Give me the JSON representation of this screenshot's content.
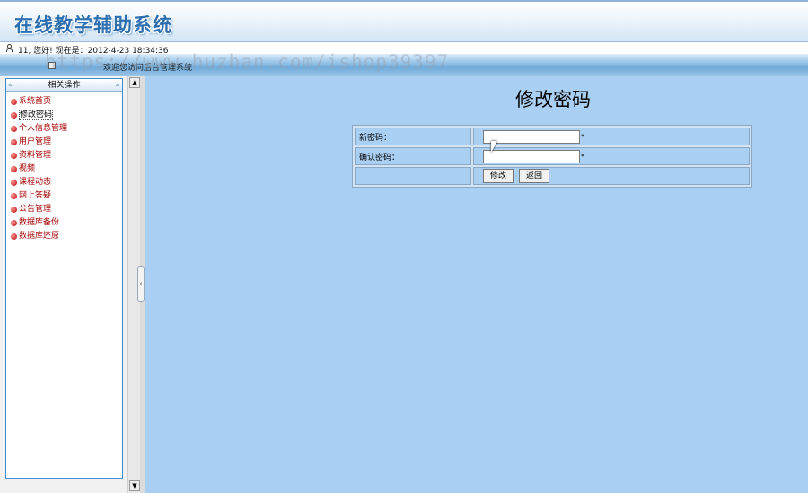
{
  "header": {
    "system_title": "在线教学辅助系统",
    "status_text": "11, 您好! 现在是：2012-4-23 18:34:36",
    "welcome_text": "欢迎您访问后台管理系统",
    "watermark": "https://www.huzhan.com/ishop39397"
  },
  "sidebar": {
    "title": "相关操作",
    "items": [
      {
        "label": "系统首页"
      },
      {
        "label": "修改密码"
      },
      {
        "label": "个人信息管理"
      },
      {
        "label": "用户管理"
      },
      {
        "label": "资料管理"
      },
      {
        "label": "视频"
      },
      {
        "label": "课程动态"
      },
      {
        "label": "网上答疑"
      },
      {
        "label": "公告管理"
      },
      {
        "label": "数据库备份"
      },
      {
        "label": "数据库还原"
      }
    ]
  },
  "main": {
    "page_title": "修改密码",
    "form": {
      "new_password_label": "新密码：",
      "new_password_value": "",
      "confirm_password_label": "确认密码：",
      "confirm_password_value": "",
      "required_mark": "*",
      "submit_label": "修改",
      "back_label": "返回"
    }
  },
  "colors": {
    "main_bg": "#a9cff2",
    "menu_text": "#a40000",
    "title_blue": "#2e6fb0"
  }
}
